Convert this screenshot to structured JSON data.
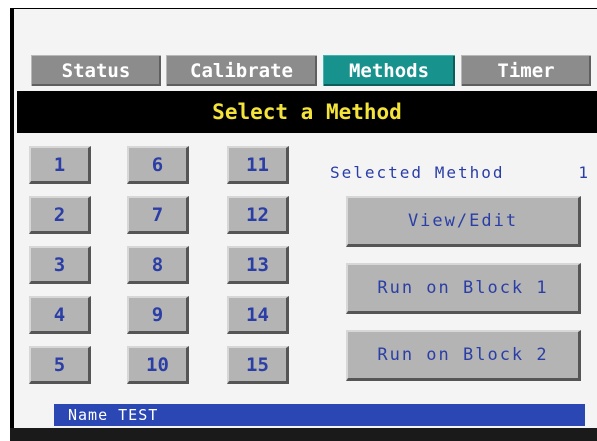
{
  "tabs": [
    "Status",
    "Calibrate",
    "Methods",
    "Timer"
  ],
  "active_tab": "Methods",
  "header": {
    "title": "Select a Method"
  },
  "methods": [
    "1",
    "2",
    "3",
    "4",
    "5",
    "6",
    "7",
    "8",
    "9",
    "10",
    "11",
    "12",
    "13",
    "14",
    "15"
  ],
  "selected": {
    "label": "Selected Method",
    "value": "1"
  },
  "actions": {
    "view_edit": "View/Edit",
    "run_block_1": "Run on Block 1",
    "run_block_2": "Run on Block 2"
  },
  "name_bar": "Name TEST",
  "colors": {
    "active_tab": "#17928c",
    "header_text": "#f3e33b",
    "button_text": "#2a3ea6",
    "name_bar": "#2a47b4"
  }
}
